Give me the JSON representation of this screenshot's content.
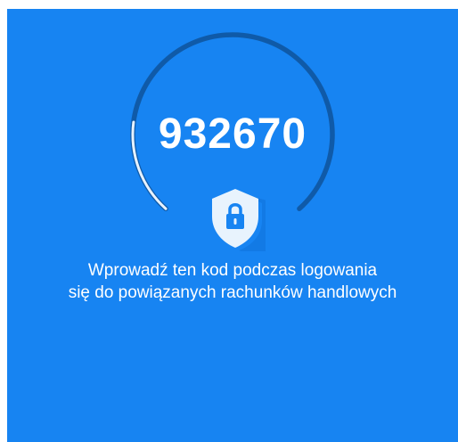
{
  "otp": {
    "code": "932670",
    "timer_progress": 0.2
  },
  "instruction": {
    "line1": "Wprowadź ten kod podczas logowania",
    "line2": "się do powiązanych rachunków handlowych"
  },
  "icons": {
    "shield": "shield-lock-icon"
  },
  "colors": {
    "background": "#1784f2",
    "ring_track": "#0f5aa8",
    "ring_progress": "#e6f2ff",
    "shield": "#e8f3fd",
    "lock": "#1784f2"
  }
}
